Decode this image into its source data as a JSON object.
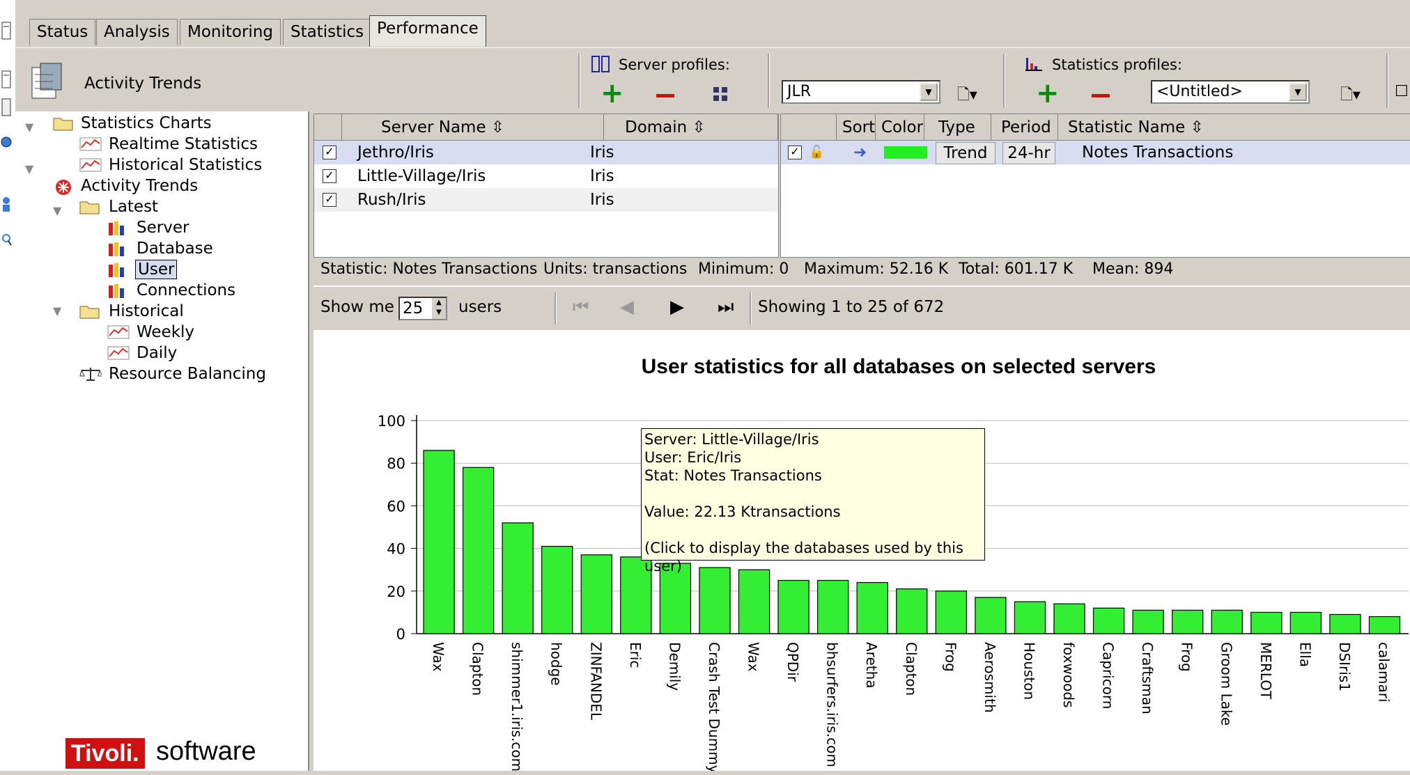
{
  "tabs": [
    "Status",
    "Analysis",
    "Monitoring",
    "Statistics",
    "Performance"
  ],
  "active_tab": "Performance",
  "header": {
    "section_title": "Activity Trends",
    "server_profiles_label": "Server profiles:",
    "statistics_profiles_label": "Statistics profiles:",
    "server_profile_value": "JLR",
    "statistics_profile_value": "<Untitled>"
  },
  "tree": {
    "items": [
      {
        "label": "Statistics Charts",
        "icon": "folder-open-icon"
      },
      {
        "label": "Realtime Statistics",
        "icon": "chart-icon"
      },
      {
        "label": "Historical Statistics",
        "icon": "chart-icon"
      },
      {
        "label": "Activity Trends",
        "icon": "activity-icon"
      },
      {
        "label": "Latest",
        "icon": "folder-open-icon"
      },
      {
        "label": "Server",
        "icon": "bar-chart-icon"
      },
      {
        "label": "Database",
        "icon": "bar-chart-icon"
      },
      {
        "label": "User",
        "icon": "bar-chart-icon"
      },
      {
        "label": "Connections",
        "icon": "bar-chart-icon"
      },
      {
        "label": "Historical",
        "icon": "folder-open-icon"
      },
      {
        "label": "Weekly",
        "icon": "chart-icon"
      },
      {
        "label": "Daily",
        "icon": "chart-icon"
      },
      {
        "label": "Resource Balancing",
        "icon": "balance-icon"
      }
    ],
    "selected": "User"
  },
  "server_grid": {
    "columns": [
      "Server Name ⇳",
      "Domain ⇳"
    ],
    "rows": [
      {
        "checked": true,
        "server": "Jethro/Iris",
        "domain": "Iris"
      },
      {
        "checked": true,
        "server": "Little-Village/Iris",
        "domain": "Iris"
      },
      {
        "checked": true,
        "server": "Rush/Iris",
        "domain": "Iris"
      }
    ]
  },
  "stat_grid": {
    "columns": [
      "Sort",
      "Color",
      "Type",
      "Period",
      "Statistic Name ⇳"
    ],
    "rows": [
      {
        "type": "Trend",
        "period": "24-hr",
        "name": "Notes Transactions",
        "color": "#22ee22"
      }
    ]
  },
  "info": {
    "statistic": "Statistic: Notes Transactions",
    "units": "Units: transactions",
    "minimum": "Minimum: 0",
    "maximum": "Maximum: 52.16 K",
    "total": "Total: 601.17 K",
    "mean": "Mean: 894"
  },
  "nav": {
    "show_me": "Show me",
    "count": "25",
    "users": "users",
    "showing": "Showing 1 to 25 of 672"
  },
  "tooltip": {
    "server": "Server: Little-Village/Iris",
    "user": "User: Eric/Iris",
    "stat": "Stat: Notes Transactions",
    "value": "Value: 22.13 Ktransactions",
    "hint": "(Click to display the databases used by this user)"
  },
  "branding": {
    "brand": "Tivoli.",
    "product": "software"
  },
  "chart_data": {
    "type": "bar",
    "title": "User statistics for all databases on selected servers",
    "categories": [
      "Wax",
      "Clapton",
      "shimmer1.iris.com",
      "hodge",
      "ZINFANDEL",
      "Eric",
      "Demily",
      "Crash Test Dummy",
      "Wax",
      "QPDir",
      "bhsurfers.iris.com",
      "Aretha",
      "Clapton",
      "Frog",
      "Aerosmith",
      "Houston",
      "foxwoods",
      "Capricorn",
      "Craftsman",
      "Frog",
      "Groom Lake",
      "MERLOT",
      "Ella",
      "DSIris1",
      "calamari"
    ],
    "values": [
      86,
      78,
      52,
      41,
      37,
      36,
      33,
      31,
      30,
      25,
      25,
      24,
      21,
      20,
      17,
      15,
      14,
      12,
      11,
      11,
      11,
      10,
      10,
      9,
      8
    ],
    "ylim": [
      0,
      100
    ],
    "yticks": [
      "0",
      "20",
      "40",
      "60",
      "80",
      "100"
    ],
    "bar_color": "#33ee33",
    "grid": true
  }
}
